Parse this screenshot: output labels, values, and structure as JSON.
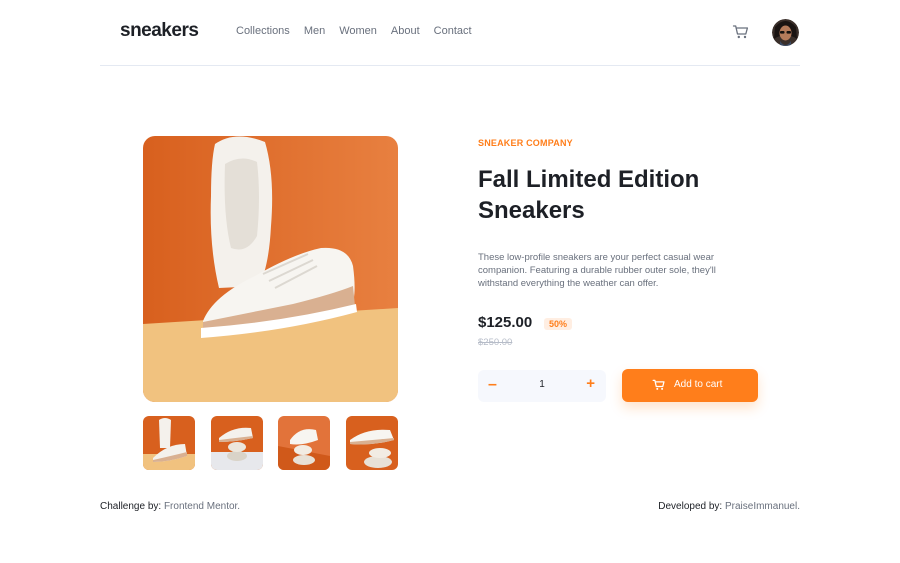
{
  "header": {
    "logo": "sneakers",
    "nav": [
      "Collections",
      "Men",
      "Women",
      "About",
      "Contact"
    ],
    "cart_icon": "cart-icon",
    "avatar_icon": "user-avatar"
  },
  "gallery": {
    "main_image": "sneaker-photo",
    "thumbnails": [
      "thumbnail-1",
      "thumbnail-2",
      "thumbnail-3",
      "thumbnail-4"
    ]
  },
  "product": {
    "company": "SNEAKER COMPANY",
    "title_line1": "Fall Limited Edition",
    "title_line2": "Sneakers",
    "description": "These low-profile sneakers are your perfect casual wear companion. Featuring a durable rubber outer sole, they'll withstand everything the weather can offer.",
    "price": "$125.00",
    "discount": "50%",
    "old_price": "$250.00"
  },
  "cart_controls": {
    "minus": "–",
    "quantity": "1",
    "plus": "+",
    "add_label": "Add to cart"
  },
  "footer": {
    "challenge_label": "Challenge by:",
    "challenge_value": "Frontend Mentor.",
    "developer_label": "Developed by:",
    "developer_value": "PraiseImmanuel."
  },
  "colors": {
    "accent": "#ff7e1b",
    "accent_pale": "#ffeee2",
    "text_dark": "#1d2026",
    "text_muted": "#69707d",
    "photo_bg": "#e06a26"
  }
}
